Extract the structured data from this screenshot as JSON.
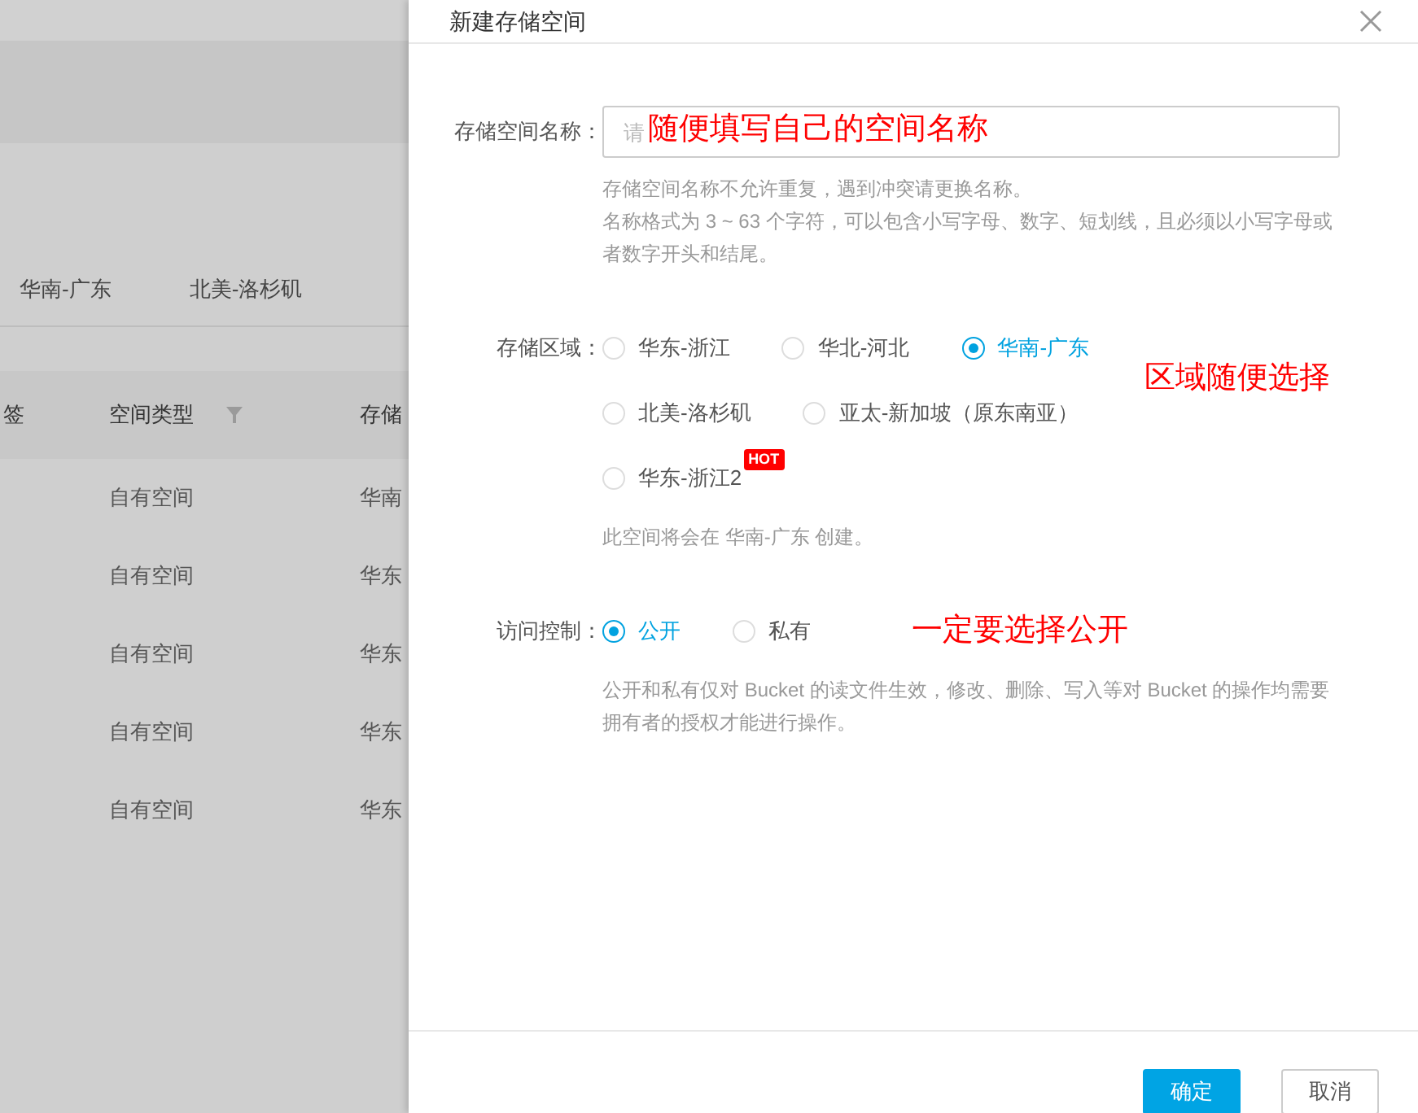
{
  "background": {
    "tabs": [
      {
        "label": "华南-广东"
      },
      {
        "label": "北美-洛杉矶"
      }
    ],
    "table": {
      "columns": [
        {
          "label": "签"
        },
        {
          "label": "空间类型",
          "filter": true
        },
        {
          "label": "存储"
        }
      ],
      "rows": [
        [
          "",
          "自有空间",
          "华南"
        ],
        [
          "",
          "自有空间",
          "华东"
        ],
        [
          "",
          "自有空间",
          "华东"
        ],
        [
          "",
          "自有空间",
          "华东"
        ],
        [
          "",
          "自有空间",
          "华东"
        ]
      ]
    }
  },
  "dialog": {
    "title": "新建存储空间",
    "name_field": {
      "label": "存储空间名称：",
      "placeholder": "请",
      "annotation": "随便填写自己的空间名称",
      "help": [
        "存储空间名称不允许重复，遇到冲突请更换名称。",
        "名称格式为 3 ~ 63 个字符，可以包含小写字母、数字、短划线，且必须以小写字母或者数字开头和结尾。"
      ]
    },
    "region": {
      "label": "存储区域：",
      "annotation": "区域随便选择",
      "rows": [
        [
          {
            "label": "华东-浙江",
            "selected": false
          },
          {
            "label": "华北-河北",
            "selected": false
          },
          {
            "label": "华南-广东",
            "selected": true
          }
        ],
        [
          {
            "label": "北美-洛杉矶",
            "selected": false
          },
          {
            "label": "亚太-新加坡（原东南亚）",
            "selected": false
          }
        ],
        [
          {
            "label": "华东-浙江2",
            "selected": false,
            "badge": "HOT"
          }
        ]
      ],
      "hint": "此空间将会在 华南-广东 创建。"
    },
    "access": {
      "label": "访问控制：",
      "annotation": "一定要选择公开",
      "options": [
        {
          "label": "公开",
          "selected": true
        },
        {
          "label": "私有",
          "selected": false
        }
      ],
      "help": "公开和私有仅对 Bucket 的读文件生效，修改、删除、写入等对 Bucket 的操作均需要拥有者的授权才能进行操作。"
    },
    "buttons": [
      {
        "label": "确定",
        "kind": "primary"
      },
      {
        "label": "取消",
        "kind": "default"
      }
    ]
  }
}
